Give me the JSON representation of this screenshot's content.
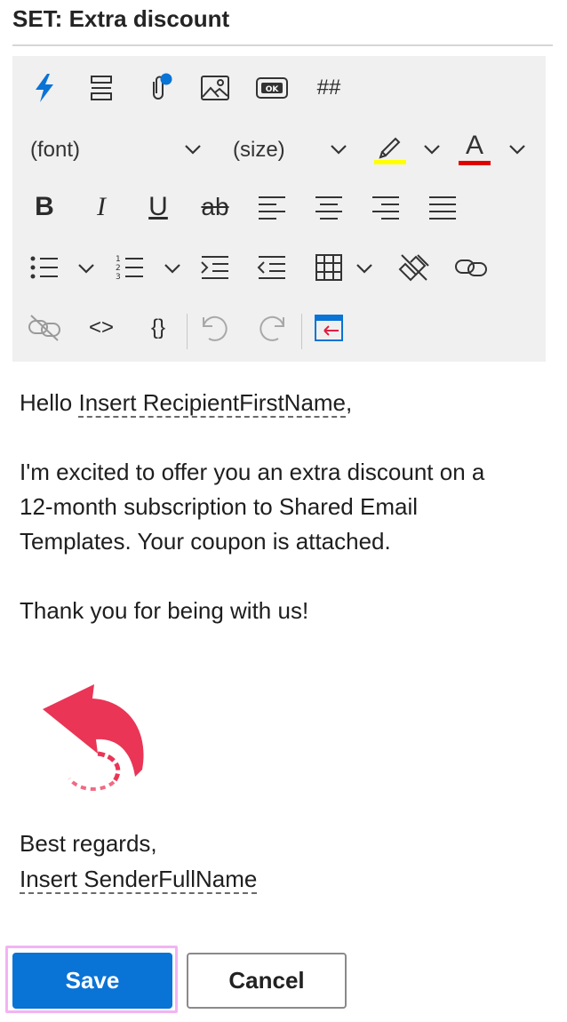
{
  "header": {
    "title": "SET: Extra discount"
  },
  "toolbar": {
    "font_label": "(font)",
    "size_label": "(size)",
    "bold_glyph": "B",
    "italic_glyph": "I",
    "underline_glyph": "U",
    "strike_glyph": "ab",
    "hash_glyph": "##",
    "code_glyph": "<>",
    "braces_glyph": "{}",
    "font_color_glyph": "A",
    "highlight_color": "#ffff00",
    "font_color": "#e00000",
    "accent": "#0a73d6",
    "icons": [
      "lightning-icon",
      "horizontal-rule-icon",
      "attachment-icon",
      "image-icon",
      "ok-button-icon",
      "hash-icon",
      "highlight-icon",
      "font-color-icon",
      "bold-icon",
      "italic-icon",
      "underline-icon",
      "strikethrough-icon",
      "align-left-icon",
      "align-center-icon",
      "align-right-icon",
      "justify-icon",
      "bullet-list-icon",
      "numbered-list-icon",
      "indent-icon",
      "outdent-icon",
      "table-icon",
      "clear-format-icon",
      "link-icon",
      "unlink-icon",
      "code-icon",
      "braces-icon",
      "undo-icon",
      "redo-icon",
      "insert-template-icon"
    ]
  },
  "message": {
    "greeting_prefix": "Hello ",
    "recipient_placeholder": "Insert RecipientFirstName",
    "greeting_suffix": ",",
    "para1_line1": "I'm excited to offer you an extra discount on a",
    "para1_line2": "12-month subscription to Shared Email",
    "para1_line3": "Templates. Your coupon is attached.",
    "thanks": "Thank you for being with us!",
    "closing": "Best regards,",
    "sender_placeholder": "Insert SenderFullName"
  },
  "footer": {
    "save_label": "Save",
    "cancel_label": "Cancel"
  }
}
